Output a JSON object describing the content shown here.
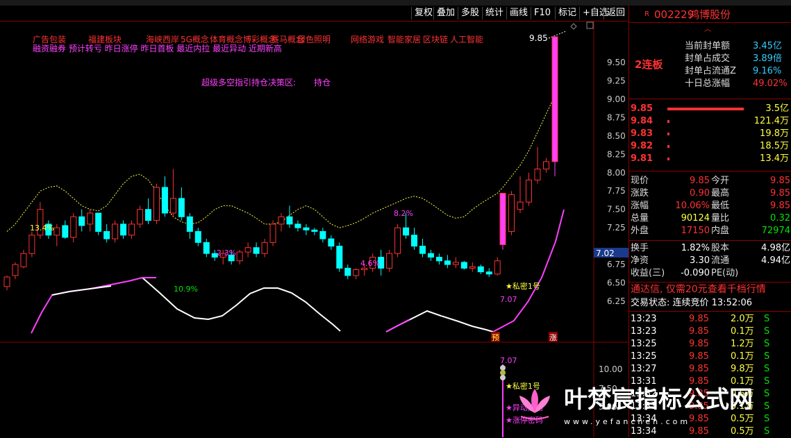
{
  "toolbar": [
    "复权",
    "叠加",
    "多股",
    "统计",
    "画线",
    "F10",
    "标记",
    "+自选",
    "返回"
  ],
  "chart": {
    "concept_line1": [
      "广告包装",
      "福建板块",
      "海峡西岸",
      "5G概念",
      "体育概念",
      "博彩概念",
      "赛马概念",
      "绿色照明",
      "网络游戏",
      "智能家居",
      "区块链",
      "人工智能"
    ],
    "concept_line2": "融资融券 预计转亏 昨日涨停 昨日首板 最近内拉 最近异动 近期新高",
    "strategy_label": "超级多空指引持仓决策区:",
    "strategy_value": "持仓",
    "top_price_label": "9.85",
    "y_ticks": [
      "9.50",
      "9.25",
      "9.00",
      "8.75",
      "8.50",
      "8.25",
      "8.00",
      "7.75",
      "7.50",
      "7.25",
      "7.00",
      "6.75",
      "6.50",
      "6.25"
    ],
    "current_price_tag": "7.02",
    "pct_labels": [
      "13.4%",
      "2.3%",
      "10.9%",
      "4.6%",
      "8.2%"
    ],
    "low_label": "7.07",
    "mark_label": "★私密1号",
    "yu_label": "预",
    "zhang_label": "涨",
    "lower": {
      "y_ticks": [
        "10.00",
        "7.50",
        "5.00"
      ],
      "price_label": "7.07",
      "mark1": "★私密1号",
      "mark2": "★异动启动",
      "mark3": "★涨停密码"
    },
    "colors": {
      "up": "#ff3232",
      "down": "#00ffff",
      "magenta": "#ff40ff",
      "yellow": "#ffff40"
    }
  },
  "chart_data": {
    "type": "candlestick",
    "ylim": [
      6.25,
      9.5
    ],
    "candles": [
      [
        6.45,
        6.6,
        6.4,
        6.58
      ],
      [
        6.6,
        6.78,
        6.55,
        6.75
      ],
      [
        6.72,
        6.95,
        6.7,
        6.9
      ],
      [
        6.9,
        7.2,
        6.85,
        7.15
      ],
      [
        7.15,
        7.6,
        7.1,
        7.5
      ],
      [
        7.3,
        7.35,
        7.1,
        7.15
      ],
      [
        7.15,
        7.3,
        7.0,
        7.25
      ],
      [
        7.28,
        7.35,
        7.1,
        7.12
      ],
      [
        7.12,
        7.45,
        7.05,
        7.4
      ],
      [
        7.4,
        7.5,
        7.2,
        7.28
      ],
      [
        7.3,
        7.5,
        7.2,
        7.45
      ],
      [
        7.45,
        7.45,
        7.15,
        7.2
      ],
      [
        7.2,
        7.3,
        7.05,
        7.1
      ],
      [
        7.1,
        7.35,
        7.05,
        7.3
      ],
      [
        7.3,
        7.35,
        7.1,
        7.15
      ],
      [
        7.15,
        7.35,
        7.1,
        7.3
      ],
      [
        7.3,
        7.55,
        7.25,
        7.5
      ],
      [
        7.5,
        7.65,
        7.3,
        7.35
      ],
      [
        7.35,
        7.85,
        7.3,
        7.8
      ],
      [
        7.8,
        7.95,
        7.4,
        7.45
      ],
      [
        7.45,
        8.05,
        7.4,
        7.65
      ],
      [
        7.65,
        7.8,
        7.35,
        7.4
      ],
      [
        7.4,
        7.45,
        7.1,
        7.2
      ],
      [
        7.2,
        7.25,
        7.0,
        7.05
      ],
      [
        7.05,
        7.1,
        6.85,
        6.9
      ],
      [
        6.9,
        6.95,
        6.8,
        6.85
      ],
      [
        6.85,
        6.95,
        6.75,
        6.9
      ],
      [
        6.88,
        6.95,
        6.75,
        6.8
      ],
      [
        6.8,
        6.95,
        6.75,
        6.92
      ],
      [
        6.92,
        7.05,
        6.85,
        6.98
      ],
      [
        6.98,
        7.05,
        6.85,
        6.9
      ],
      [
        6.9,
        7.1,
        6.85,
        7.05
      ],
      [
        7.05,
        7.35,
        7.0,
        7.3
      ],
      [
        7.3,
        7.45,
        7.2,
        7.4
      ],
      [
        7.4,
        7.55,
        7.25,
        7.3
      ],
      [
        7.3,
        7.35,
        7.2,
        7.25
      ],
      [
        7.25,
        7.3,
        7.15,
        7.22
      ],
      [
        7.22,
        7.25,
        7.15,
        7.2
      ],
      [
        7.2,
        7.25,
        7.05,
        7.1
      ],
      [
        7.1,
        7.15,
        6.95,
        7.0
      ],
      [
        7.0,
        7.05,
        6.65,
        6.7
      ],
      [
        6.7,
        6.75,
        6.55,
        6.6
      ],
      [
        6.6,
        6.7,
        6.55,
        6.68
      ],
      [
        6.68,
        6.75,
        6.6,
        6.7
      ],
      [
        6.7,
        6.9,
        6.65,
        6.85
      ],
      [
        6.85,
        6.95,
        6.6,
        6.7
      ],
      [
        6.7,
        6.95,
        6.65,
        6.9
      ],
      [
        6.9,
        7.3,
        6.85,
        7.25
      ],
      [
        7.25,
        7.45,
        7.1,
        7.15
      ],
      [
        7.15,
        7.25,
        6.95,
        7.0
      ],
      [
        7.0,
        7.1,
        6.85,
        6.9
      ],
      [
        6.9,
        6.95,
        6.8,
        6.85
      ],
      [
        6.85,
        6.9,
        6.75,
        6.8
      ],
      [
        6.8,
        6.88,
        6.7,
        6.75
      ],
      [
        6.75,
        6.85,
        6.7,
        6.78
      ],
      [
        6.78,
        6.8,
        6.68,
        6.7
      ],
      [
        6.7,
        6.78,
        6.65,
        6.72
      ],
      [
        6.72,
        6.75,
        6.62,
        6.65
      ],
      [
        6.65,
        6.7,
        6.58,
        6.62
      ],
      [
        6.62,
        6.85,
        6.6,
        6.8
      ],
      [
        7.02,
        7.72,
        6.95,
        7.72
      ],
      [
        7.2,
        7.75,
        7.15,
        7.7
      ],
      [
        7.5,
        7.95,
        7.45,
        7.6
      ],
      [
        7.6,
        8.0,
        7.55,
        7.9
      ],
      [
        7.9,
        8.35,
        7.85,
        8.05
      ],
      [
        8.05,
        8.2,
        8.0,
        8.15
      ],
      [
        8.15,
        9.85,
        7.95,
        9.85
      ]
    ],
    "series": [
      {
        "name": "",
        "values": []
      }
    ]
  }
}
